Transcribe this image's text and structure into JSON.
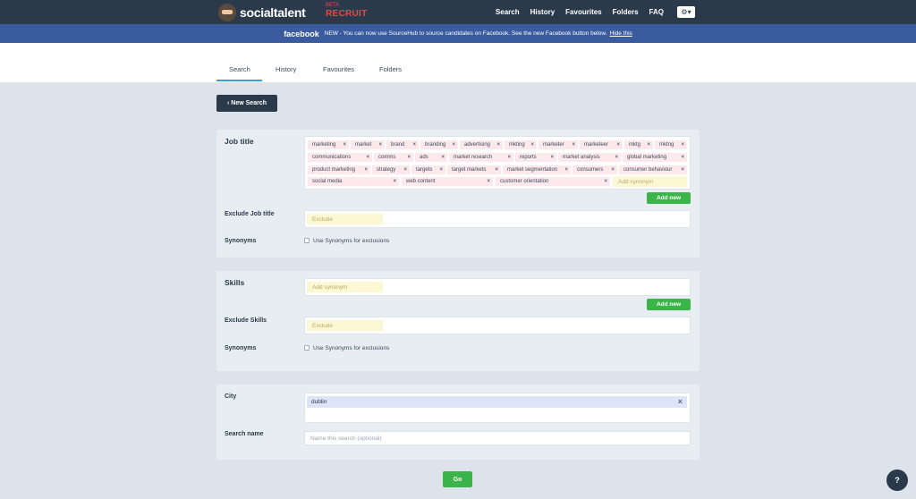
{
  "brand": {
    "name": "socialtalent",
    "beta": "BETA",
    "product": "RECRUIT"
  },
  "nav": {
    "items": [
      "Search",
      "History",
      "Favourites",
      "Folders",
      "FAQ"
    ],
    "settings_icon": "⚙▾"
  },
  "banner": {
    "brand": "facebook",
    "message": "NEW - You can now use SourceHub to source candidates on Facebook. See the new Facebook button below.",
    "hide_link": "Hide this"
  },
  "tabs": [
    "Search",
    "History",
    "Favourites",
    "Folders"
  ],
  "new_search_label": "‹ New Search",
  "job_title": {
    "label": "Job title",
    "tags": [
      "marketing",
      "market",
      "brand",
      "branding",
      "advertising",
      "mkting",
      "marketer",
      "marketeer",
      "mktg",
      "mktng",
      "communications",
      "comms",
      "ads",
      "market research",
      "reports",
      "market analysis",
      "global marketing",
      "product marketing",
      "strategy",
      "targets",
      "target markets",
      "market segmentation",
      "consumers",
      "consumer behaviour",
      "social media",
      "web content",
      "customer orientation"
    ],
    "add_synonym_placeholder": "Add synonym",
    "add_new_label": "Add new",
    "exclude_label": "Exclude Job title",
    "exclude_placeholder": "Exclude",
    "synonyms_label": "Synonyms",
    "synonyms_checkbox_label": "Use Synonyms for exclusions"
  },
  "skills": {
    "label": "Skills",
    "add_synonym_placeholder": "Add synonym",
    "add_new_label": "Add new",
    "exclude_label": "Exclude Skills",
    "exclude_placeholder": "Exclude",
    "synonyms_label": "Synonyms",
    "synonyms_checkbox_label": "Use Synonyms for exclusions"
  },
  "location": {
    "city_label": "City",
    "city_value": "dublin",
    "search_name_label": "Search name",
    "search_name_placeholder": "Name this search (optional)"
  },
  "go_label": "Go",
  "help_icon": "?",
  "close_glyph": "×"
}
